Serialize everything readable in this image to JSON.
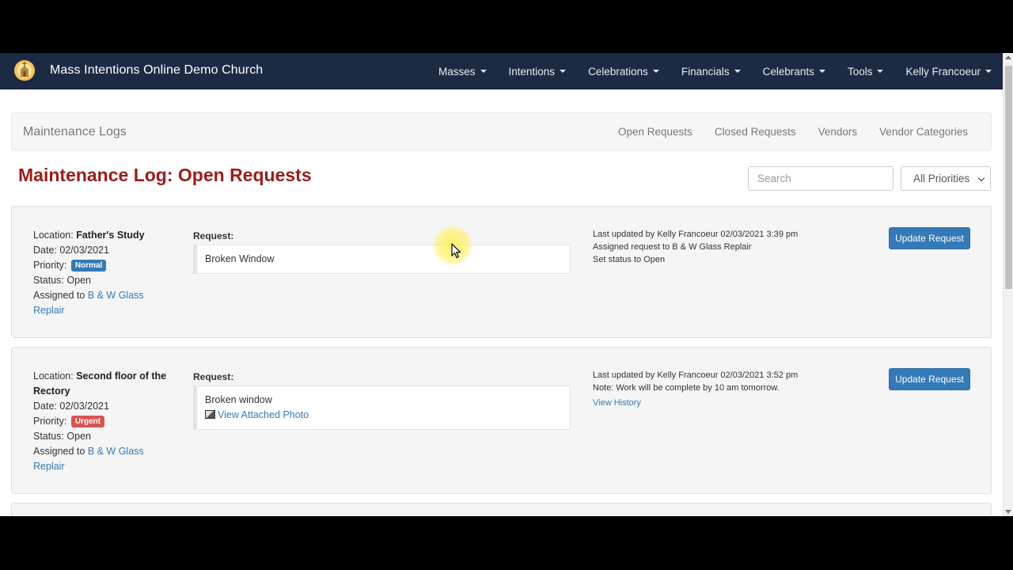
{
  "navbar": {
    "brand_name": "Mass Intentions Online Demo Church",
    "menu": [
      {
        "label": "Masses"
      },
      {
        "label": "Intentions"
      },
      {
        "label": "Celebrations"
      },
      {
        "label": "Financials"
      },
      {
        "label": "Celebrants"
      },
      {
        "label": "Tools"
      },
      {
        "label": "Kelly Francoeur"
      }
    ]
  },
  "subnav": {
    "title": "Maintenance Logs",
    "links": [
      "Open Requests",
      "Closed Requests",
      "Vendors",
      "Vendor Categories"
    ]
  },
  "page": {
    "title": "Maintenance Log: Open Requests",
    "search_placeholder": "Search",
    "priority_filter": "All Priorities"
  },
  "labels": {
    "location": "Location:",
    "date": "Date:",
    "priority": "Priority:",
    "status": "Status:",
    "assigned": "Assigned to",
    "request": "Request:",
    "update_button": "Update Request"
  },
  "requests": [
    {
      "location": "Father's Study",
      "date": "02/03/2021",
      "priority": "Normal",
      "status": "Open",
      "assigned_to": "B & W Glass Replair",
      "request_text": "Broken Window",
      "log": [
        "Last updated by Kelly Francoeur 02/03/2021 3:39 pm",
        "Assigned request to B & W Glass Replair",
        "Set status to Open"
      ]
    },
    {
      "location": "Second floor of the Rectory",
      "date": "02/03/2021",
      "priority": "Urgent",
      "status": "Open",
      "assigned_to": "B & W Glass Replair",
      "request_text": "Broken window",
      "photo_link": "View Attached Photo",
      "log": [
        "Last updated by Kelly Francoeur 02/03/2021 3:52 pm",
        "Note: Work will be complete by 10 am tomorrow."
      ],
      "history_link": "View History"
    }
  ],
  "colors": {
    "navbar_bg": "#1d2a44",
    "title_red": "#9b1c1c",
    "primary_blue": "#337ab7",
    "urgent_red": "#d9534f"
  }
}
